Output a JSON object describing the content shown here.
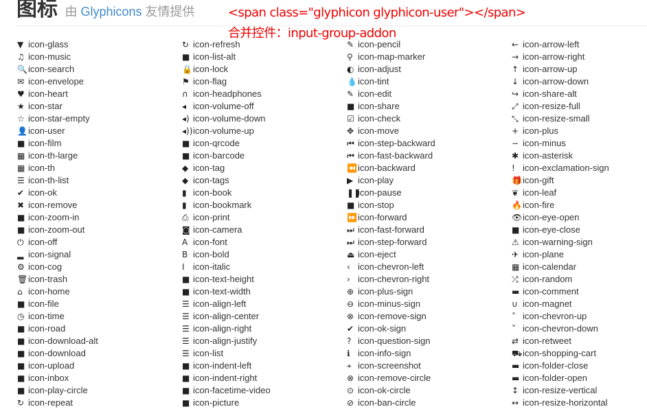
{
  "header": {
    "title": "图标",
    "sub_prefix": "由",
    "sub_link": "Glyphicons",
    "sub_suffix": "友情提供"
  },
  "annotation": {
    "line1": "<span class=\"glyphicon glyphicon-user\"></span>",
    "line2": "合并控件：input-group-addon"
  },
  "columns": [
    [
      "icon-glass",
      "icon-music",
      "icon-search",
      "icon-envelope",
      "icon-heart",
      "icon-star",
      "icon-star-empty",
      "icon-user",
      "icon-film",
      "icon-th-large",
      "icon-th",
      "icon-th-list",
      "icon-ok",
      "icon-remove",
      "icon-zoom-in",
      "icon-zoom-out",
      "icon-off",
      "icon-signal",
      "icon-cog",
      "icon-trash",
      "icon-home",
      "icon-file",
      "icon-time",
      "icon-road",
      "icon-download-alt",
      "icon-download",
      "icon-upload",
      "icon-inbox",
      "icon-play-circle",
      "icon-repeat"
    ],
    [
      "icon-refresh",
      "icon-list-alt",
      "icon-lock",
      "icon-flag",
      "icon-headphones",
      "icon-volume-off",
      "icon-volume-down",
      "icon-volume-up",
      "icon-qrcode",
      "icon-barcode",
      "icon-tag",
      "icon-tags",
      "icon-book",
      "icon-bookmark",
      "icon-print",
      "icon-camera",
      "icon-font",
      "icon-bold",
      "icon-italic",
      "icon-text-height",
      "icon-text-width",
      "icon-align-left",
      "icon-align-center",
      "icon-align-right",
      "icon-align-justify",
      "icon-list",
      "icon-indent-left",
      "icon-indent-right",
      "icon-facetime-video",
      "icon-picture"
    ],
    [
      "icon-pencil",
      "icon-map-marker",
      "icon-adjust",
      "icon-tint",
      "icon-edit",
      "icon-share",
      "icon-check",
      "icon-move",
      "icon-step-backward",
      "icon-fast-backward",
      "icon-backward",
      "icon-play",
      "icon-pause",
      "icon-stop",
      "icon-forward",
      "icon-fast-forward",
      "icon-step-forward",
      "icon-eject",
      "icon-chevron-left",
      "icon-chevron-right",
      "icon-plus-sign",
      "icon-minus-sign",
      "icon-remove-sign",
      "icon-ok-sign",
      "icon-question-sign",
      "icon-info-sign",
      "icon-screenshot",
      "icon-remove-circle",
      "icon-ok-circle",
      "icon-ban-circle"
    ],
    [
      "icon-arrow-left",
      "icon-arrow-right",
      "icon-arrow-up",
      "icon-arrow-down",
      "icon-share-alt",
      "icon-resize-full",
      "icon-resize-small",
      "icon-plus",
      "icon-minus",
      "icon-asterisk",
      "icon-exclamation-sign",
      "icon-gift",
      "icon-leaf",
      "icon-fire",
      "icon-eye-open",
      "icon-eye-close",
      "icon-warning-sign",
      "icon-plane",
      "icon-calendar",
      "icon-random",
      "icon-comment",
      "icon-magnet",
      "icon-chevron-up",
      "icon-chevron-down",
      "icon-retweet",
      "icon-shopping-cart",
      "icon-folder-close",
      "icon-folder-open",
      "icon-resize-vertical",
      "icon-resize-horizontal"
    ]
  ]
}
